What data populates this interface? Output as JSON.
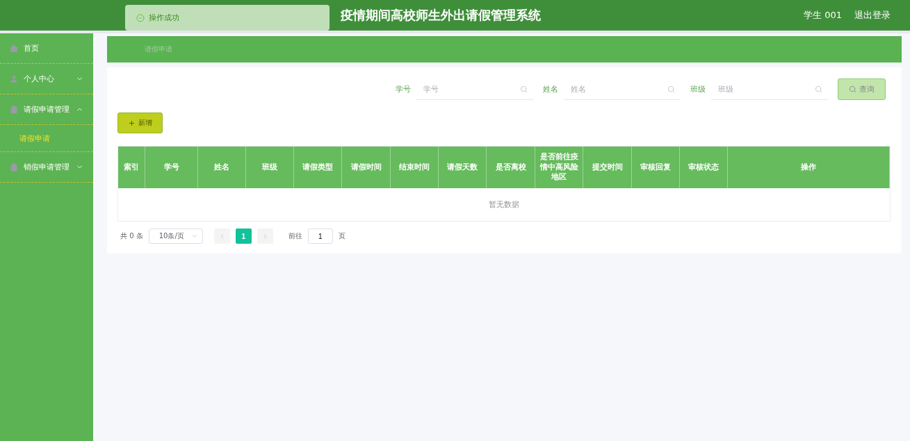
{
  "header": {
    "title": "疫情期间高校师生外出请假管理系统",
    "user": "学生 001",
    "logout": "退出登录"
  },
  "toast": {
    "message": "操作成功"
  },
  "sidebar": {
    "items": [
      {
        "label": "首页",
        "has_children": false
      },
      {
        "label": "个人中心",
        "expanded": false,
        "has_children": true
      },
      {
        "label": "请假申请管理",
        "expanded": true,
        "has_children": true,
        "children": [
          {
            "label": "请假申请",
            "selected": true
          }
        ]
      },
      {
        "label": "销假申请管理",
        "expanded": false,
        "has_children": true
      }
    ]
  },
  "breadcrumb": "请假申请",
  "search": {
    "fields": [
      {
        "label": "学号",
        "placeholder": "学号"
      },
      {
        "label": "姓名",
        "placeholder": "姓名"
      },
      {
        "label": "班级",
        "placeholder": "班级"
      }
    ],
    "button": "查询"
  },
  "add_button": "新增",
  "table": {
    "columns": [
      "索引",
      "学号",
      "姓名",
      "班级",
      "请假类型",
      "请假时间",
      "结束时间",
      "请假天数",
      "是否离校",
      "是否前往疫情中高风险地区",
      "提交时间",
      "审核回复",
      "审核状态",
      "操作"
    ],
    "empty_text": "暂无数据"
  },
  "pagination": {
    "total": "共 0 条",
    "page_size": "10条/页",
    "pages": [
      {
        "label": "1",
        "selected": true
      }
    ],
    "goto_label": "前往",
    "goto_value": "1",
    "goto_suffix": "页"
  }
}
